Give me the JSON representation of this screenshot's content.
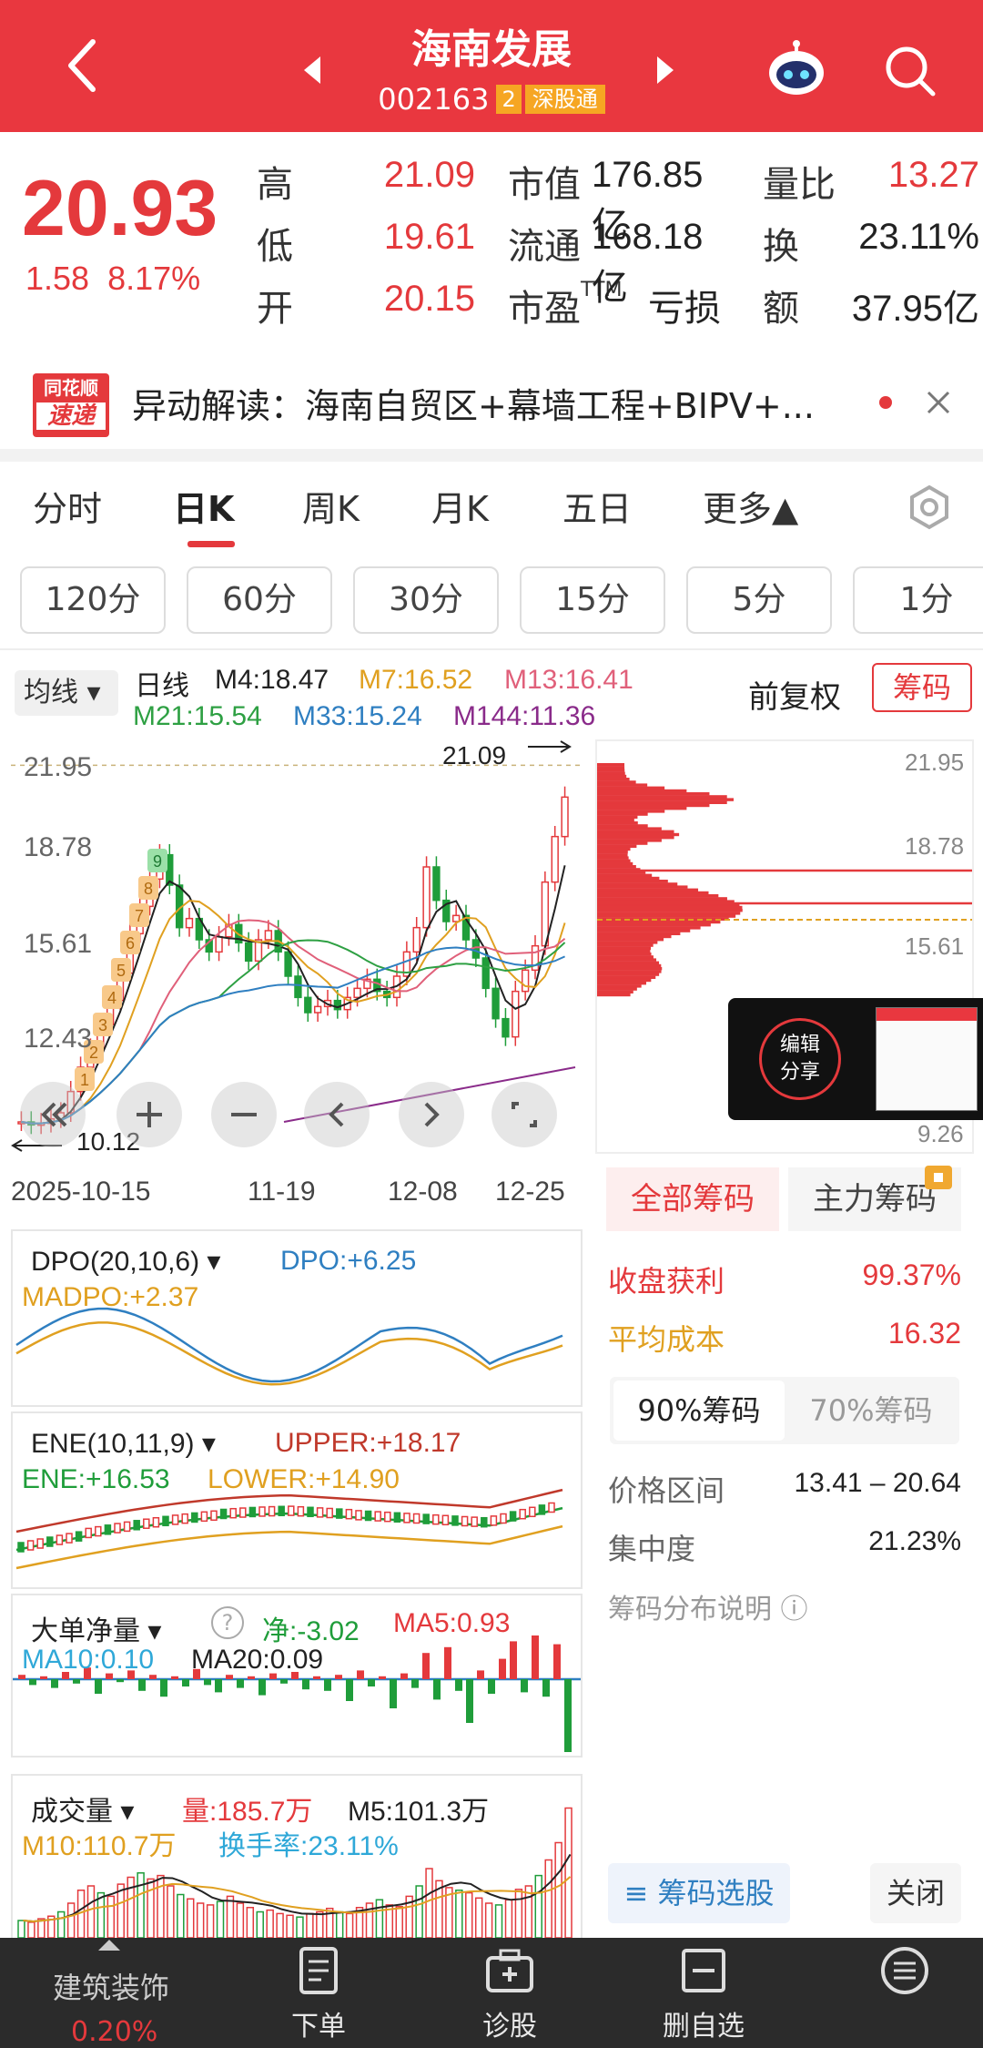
{
  "header": {
    "title": "海南发展",
    "code": "002163",
    "badge": "2",
    "market": "深股通"
  },
  "quote": {
    "price": "20.93",
    "change": "1.58",
    "change_pct": "8.17%",
    "high_label": "高",
    "high": "21.09",
    "low_label": "低",
    "low": "19.61",
    "open_label": "开",
    "open": "20.15",
    "mcap_label": "市值",
    "mcap": "176.85亿",
    "float_label": "流通",
    "float": "168.18亿",
    "pe_label": "市盈TTM",
    "pe": "亏损",
    "vol_ratio_label": "量比",
    "vol_ratio": "13.27",
    "turnover_label": "换",
    "turnover": "23.11%",
    "amount_label": "额",
    "amount": "37.95亿"
  },
  "news": {
    "logo_top": "同花顺",
    "logo_bottom": "速递",
    "text": "异动解读：海南自贸区+幕墙工程+BIPV+..."
  },
  "tabs": [
    "分时",
    "日K",
    "周K",
    "月K",
    "五日",
    "更多▲"
  ],
  "minute_buttons": [
    "120分",
    "60分",
    "30分",
    "15分",
    "5分",
    "1分"
  ],
  "kline": {
    "ma_selector": "均线",
    "period": "日线",
    "ma": [
      {
        "text": "M4:18.47",
        "color": "#222222"
      },
      {
        "text": "M7:16.52",
        "color": "#e0a020"
      },
      {
        "text": "M13:16.41",
        "color": "#e0607a"
      },
      {
        "text": "M21:15.54",
        "color": "#2ea043"
      },
      {
        "text": "M33:15.24",
        "color": "#2f7fc1"
      },
      {
        "text": "M144:11.36",
        "color": "#8a2b8a"
      }
    ],
    "adjust": "前复权",
    "chip_btn": "筹码",
    "y_ticks": [
      "21.95",
      "18.78",
      "15.61",
      "12.43"
    ],
    "max_marker": "21.09",
    "min_marker": "10.12",
    "dates": [
      "2025-10-15",
      "11-19",
      "12-08",
      "12-25"
    ],
    "seq_marks": [
      "1",
      "2",
      "3",
      "4",
      "5",
      "6",
      "7",
      "8",
      "9"
    ]
  },
  "chips": {
    "y_ticks": [
      "21.95",
      "18.78",
      "15.61",
      "9.26"
    ],
    "tab_all": "全部筹码",
    "tab_main": "主力筹码",
    "profit_label": "收盘获利",
    "profit": "99.37%",
    "avg_label": "平均成本",
    "avg": "16.32",
    "sub_90": "90%筹码",
    "sub_70": "70%筹码",
    "range_label": "价格区间",
    "range": "13.41 – 20.64",
    "conc_label": "集中度",
    "conc": "21.23%",
    "explain": "筹码分布说明",
    "select_btn": "筹码选股",
    "close_btn": "关闭",
    "edit_share": "编辑\n分享"
  },
  "dpo": {
    "name": "DPO(20,10,6)",
    "dpo": "DPO:+6.25",
    "madpo": "MADPO:+2.37"
  },
  "ene": {
    "name": "ENE(10,11,9)",
    "upper": "UPPER:+18.17",
    "ene": "ENE:+16.53",
    "lower": "LOWER:+14.90"
  },
  "bigorder": {
    "name": "大单净量",
    "net": "净:-3.02",
    "ma5": "MA5:0.93",
    "ma10": "MA10:0.10",
    "ma20": "MA20:0.09"
  },
  "volume": {
    "name": "成交量",
    "vol": "量:185.7万",
    "m5": "M5:101.3万",
    "m10": "M10:110.7万",
    "turnover": "换手率:23.11%"
  },
  "bottom_bar": {
    "sector": "建筑装饰",
    "sector_chg": "0.20%",
    "order": "下单",
    "diagnose": "诊股",
    "remove_fav": "删自选",
    "more": ""
  },
  "colors": {
    "red": "#e9373f",
    "green": "#1f9d3a",
    "blue": "#2f7fc1",
    "orange": "#e0a020"
  }
}
